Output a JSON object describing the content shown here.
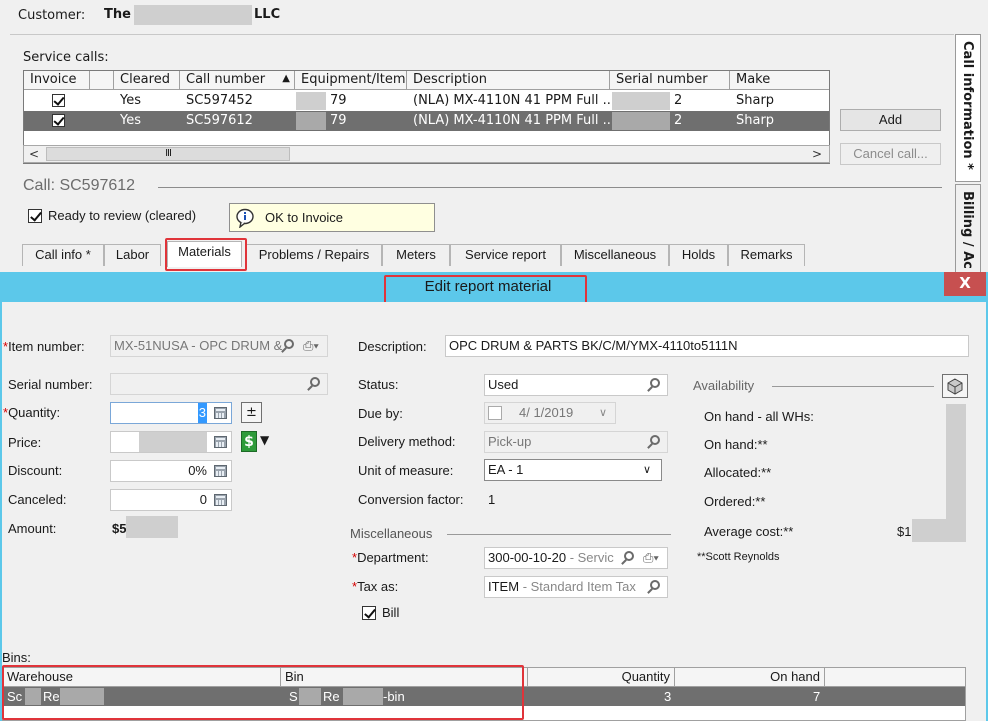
{
  "customer": {
    "label": "Customer:",
    "name_start": "The",
    "name_end": "LLC"
  },
  "service_calls": {
    "label": "Service calls:",
    "columns": [
      "Invoice",
      "Cleared",
      "Call number",
      "Equipment/Item",
      "Description",
      "Serial number",
      "Make"
    ],
    "rows": [
      {
        "invoice": true,
        "cleared": "Yes",
        "call_number": "SC597452",
        "equipment": "79",
        "description": "(NLA) MX-4110N 41 PPM Full ...",
        "serial": "2",
        "make": "Sharp",
        "selected": false
      },
      {
        "invoice": true,
        "cleared": "Yes",
        "call_number": "SC597612",
        "equipment": "79",
        "description": "(NLA) MX-4110N 41 PPM Full ...",
        "serial": "2",
        "make": "Sharp",
        "selected": true
      }
    ],
    "scroll_left": "<",
    "scroll_right": ">",
    "scroll_thumb": "III"
  },
  "buttons": {
    "add": "Add",
    "cancel_call": "Cancel call..."
  },
  "call": {
    "title": "Call: SC597612",
    "ready_label": "Ready to review (cleared)",
    "ok_to_invoice": "OK to Invoice"
  },
  "tabs": [
    "Call info *",
    "Labor",
    "Materials",
    "Problems / Repairs",
    "Meters",
    "Service report",
    "Miscellaneous",
    "Holds",
    "Remarks"
  ],
  "side_tabs": [
    "Call information *",
    "Billing / Ac"
  ],
  "dialog": {
    "title": "Edit report material",
    "close": "X",
    "left": {
      "item_number_label": "Item number:",
      "item_number_value": "MX-51NUSA - OPC DRUM &",
      "serial_number_label": "Serial number:",
      "quantity_label": "Quantity:",
      "quantity_value": "3",
      "price_label": "Price:",
      "discount_label": "Discount:",
      "discount_value": "0%",
      "canceled_label": "Canceled:",
      "canceled_value": "0",
      "amount_label": "Amount:",
      "amount_value": "$5"
    },
    "middle": {
      "description_label": "Description:",
      "description_value": "OPC DRUM & PARTS BK/C/M/YMX-4110to5111N",
      "status_label": "Status:",
      "status_value": "Used",
      "due_by_label": "Due by:",
      "due_by_value": "4/  1/2019",
      "delivery_label": "Delivery method:",
      "delivery_value": "Pick-up",
      "uom_label": "Unit of measure:",
      "uom_value": "EA - 1",
      "conversion_label": "Conversion factor:",
      "conversion_value": "1",
      "misc_section": "Miscellaneous",
      "department_label": "Department:",
      "department_value": "300-00-10-20",
      "department_suffix": "- Servic",
      "tax_label": "Tax as:",
      "tax_value": "ITEM",
      "tax_suffix": "- Standard Item Tax",
      "bill_label": "Bill"
    },
    "availability": {
      "section": "Availability",
      "on_hand_all": "On hand - all WHs:",
      "on_hand": "On hand:**",
      "allocated": "Allocated:**",
      "ordered": "Ordered:**",
      "average_cost": "Average cost:**",
      "average_cost_value": "$1",
      "footnote": "**Scott Reynolds"
    },
    "bins": {
      "label": "Bins:",
      "columns": [
        "Warehouse",
        "Bin",
        "Quantity",
        "On hand"
      ],
      "row": {
        "warehouse_a": "Sc",
        "warehouse_b": "Re",
        "bin_a": "S",
        "bin_b": "Re",
        "bin_c": "-bin",
        "quantity": "3",
        "on_hand": "7"
      }
    }
  }
}
